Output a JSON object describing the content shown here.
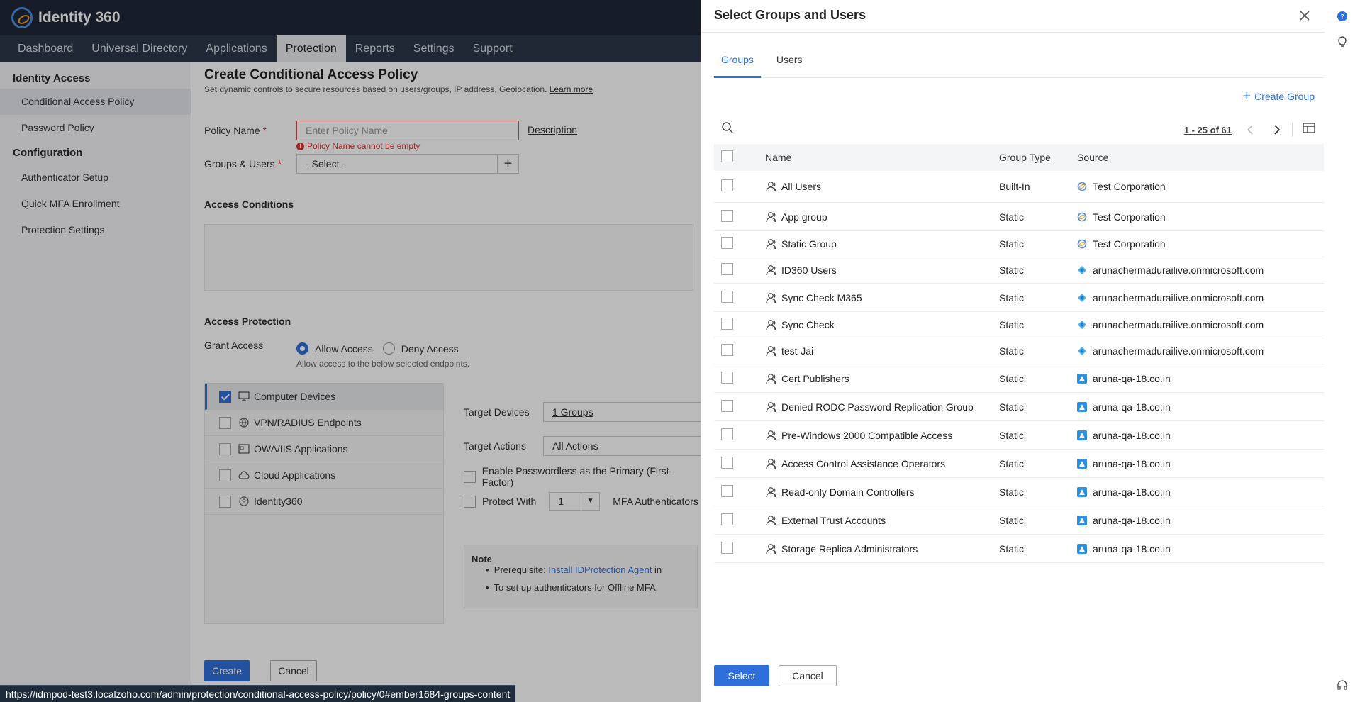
{
  "app": {
    "title": "Identity 360"
  },
  "nav": [
    {
      "label": "Dashboard",
      "active": false
    },
    {
      "label": "Universal Directory",
      "active": false
    },
    {
      "label": "Applications",
      "active": false
    },
    {
      "label": "Protection",
      "active": true
    },
    {
      "label": "Reports",
      "active": false
    },
    {
      "label": "Settings",
      "active": false
    },
    {
      "label": "Support",
      "active": false
    }
  ],
  "sidebar": {
    "section1": "Identity Access",
    "items1": [
      "Conditional Access Policy",
      "Password Policy"
    ],
    "section2": "Configuration",
    "items2": [
      "Authenticator Setup",
      "Quick MFA Enrollment",
      "Protection Settings"
    ]
  },
  "page": {
    "title": "Create Conditional Access Policy",
    "subtitle": "Set dynamic controls to secure resources based on users/groups, IP address, Geolocation.",
    "learn_more": "Learn more",
    "policy_name_label": "Policy Name",
    "policy_name_placeholder": "Enter Policy Name",
    "policy_name_error": "Policy Name cannot be empty",
    "description_link": "Description",
    "groups_users_label": "Groups & Users",
    "groups_users_value": "- Select -",
    "access_conditions": "Access Conditions",
    "access_protection": "Access Protection",
    "grant_access_label": "Grant Access",
    "allow_access": "Allow Access",
    "deny_access": "Deny Access",
    "allow_hint": "Allow access to the below selected endpoints.",
    "endpoints": [
      {
        "label": "Computer Devices",
        "checked": true
      },
      {
        "label": "VPN/RADIUS Endpoints",
        "checked": false
      },
      {
        "label": "OWA/IIS Applications",
        "checked": false
      },
      {
        "label": "Cloud Applications",
        "checked": false
      },
      {
        "label": "Identity360",
        "checked": false
      }
    ],
    "target_devices_label": "Target Devices",
    "target_devices_value": "1 Groups",
    "target_actions_label": "Target Actions",
    "target_actions_value": "All Actions",
    "passwordless_label": "Enable Passwordless as the Primary (First-Factor)",
    "protect_with_label": "Protect With",
    "protect_with_value": "1",
    "mfa_label": "MFA Authenticators",
    "note_title": "Note",
    "note_prereq": "Prerequisite:",
    "note_link": "Install IDProtection Agent",
    "note_in": "in",
    "note_2": "To set up authenticators for Offline MFA,",
    "create_btn": "Create",
    "cancel_btn": "Cancel"
  },
  "status_url": "https://idmpod-test3.localzoho.com/admin/protection/conditional-access-policy/policy/0#ember1684-groups-content",
  "drawer": {
    "title": "Select Groups and Users",
    "tabs": [
      {
        "label": "Groups",
        "active": true
      },
      {
        "label": "Users",
        "active": false
      }
    ],
    "create_group": "Create Group",
    "pager": "1 - 25 of 61",
    "columns": {
      "name": "Name",
      "type": "Group Type",
      "source": "Source"
    },
    "rows": [
      {
        "name": "All Users",
        "type": "Built-In",
        "source": "Test Corporation",
        "src_kind": "corp"
      },
      {
        "name": "App group",
        "type": "Static",
        "source": "Test Corporation",
        "src_kind": "corp"
      },
      {
        "name": "Static Group",
        "type": "Static",
        "source": "Test Corporation",
        "src_kind": "corp"
      },
      {
        "name": "ID360 Users",
        "type": "Static",
        "source": "arunachermadurailive.onmicrosoft.com",
        "src_kind": "azure"
      },
      {
        "name": "Sync Check M365",
        "type": "Static",
        "source": "arunachermadurailive.onmicrosoft.com",
        "src_kind": "azure"
      },
      {
        "name": "Sync Check",
        "type": "Static",
        "source": "arunachermadurailive.onmicrosoft.com",
        "src_kind": "azure"
      },
      {
        "name": "test-Jai",
        "type": "Static",
        "source": "arunachermadurailive.onmicrosoft.com",
        "src_kind": "azure"
      },
      {
        "name": "Cert Publishers",
        "type": "Static",
        "source": "aruna-qa-18.co.in",
        "src_kind": "ad"
      },
      {
        "name": "Denied RODC Password Replication Group",
        "type": "Static",
        "source": "aruna-qa-18.co.in",
        "src_kind": "ad"
      },
      {
        "name": "Pre-Windows 2000 Compatible Access",
        "type": "Static",
        "source": "aruna-qa-18.co.in",
        "src_kind": "ad"
      },
      {
        "name": "Access Control Assistance Operators",
        "type": "Static",
        "source": "aruna-qa-18.co.in",
        "src_kind": "ad"
      },
      {
        "name": "Read-only Domain Controllers",
        "type": "Static",
        "source": "aruna-qa-18.co.in",
        "src_kind": "ad"
      },
      {
        "name": "External Trust Accounts",
        "type": "Static",
        "source": "aruna-qa-18.co.in",
        "src_kind": "ad"
      },
      {
        "name": "Storage Replica Administrators",
        "type": "Static",
        "source": "aruna-qa-18.co.in",
        "src_kind": "ad"
      }
    ],
    "select_btn": "Select",
    "cancel_btn": "Cancel"
  },
  "colors": {
    "accent": "#2f6fdb",
    "header": "#1f2937",
    "nav": "#2b3848",
    "error": "#d33333"
  }
}
